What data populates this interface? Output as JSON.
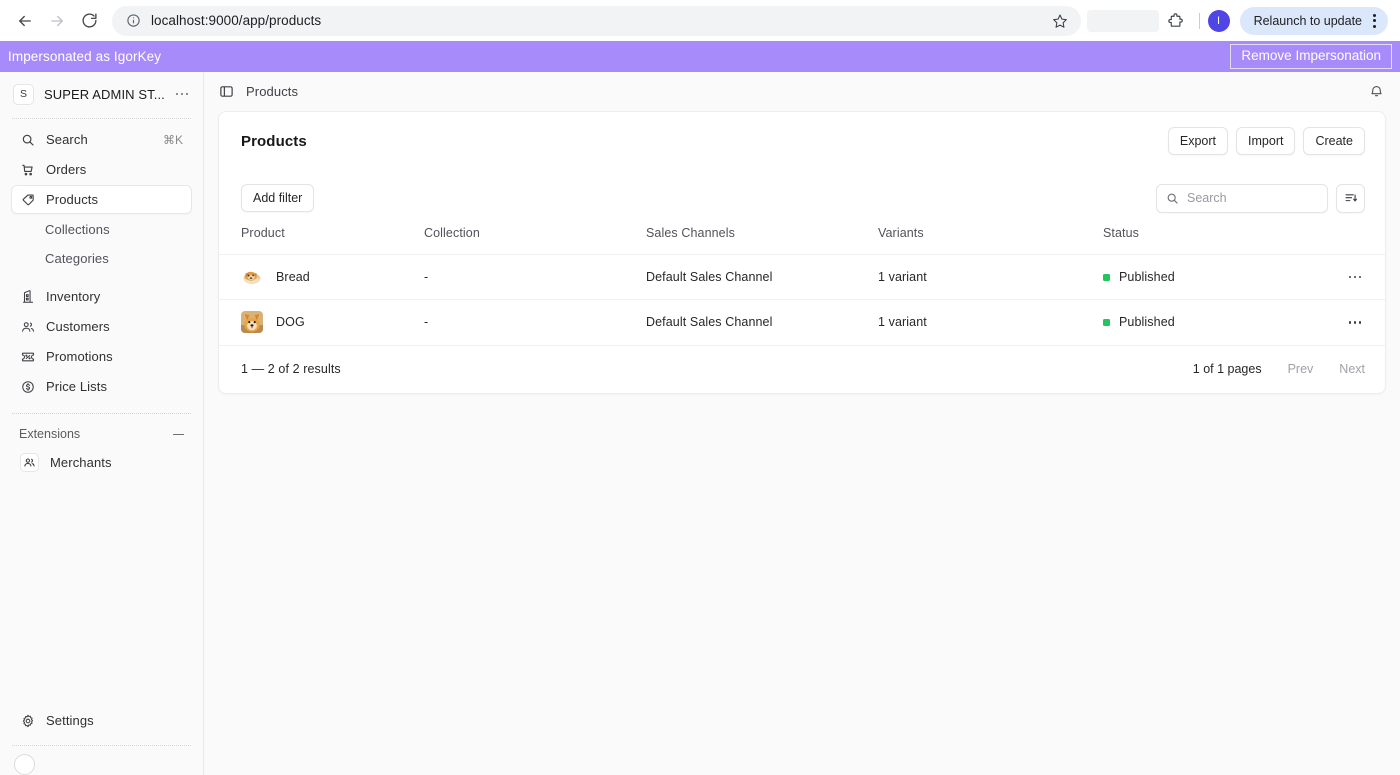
{
  "browser": {
    "back_icon": "arrow-left-icon",
    "forward_icon": "arrow-right-icon",
    "reload_icon": "reload-icon",
    "site_info_icon": "info-circle-icon",
    "url": "localhost:9000/app/products",
    "bookmark_icon": "star-icon",
    "extensions_icon": "puzzle-icon",
    "profile_initial": "I",
    "relaunch_label": "Relaunch to update",
    "kebab_icon": "three-dots-vertical-icon"
  },
  "impersonation": {
    "text": "Impersonated as IgorKey",
    "button_label": "Remove Impersonation",
    "banner_color": "#a78bfa"
  },
  "sidebar": {
    "store_initial": "S",
    "store_name": "SUPER ADMIN ST...",
    "store_menu_icon": "three-dots-icon",
    "items": [
      {
        "label": "Search",
        "icon": "search-icon",
        "shortcut": "⌘K",
        "active": false
      },
      {
        "label": "Orders",
        "icon": "cart-icon",
        "shortcut": "",
        "active": false
      },
      {
        "label": "Products",
        "icon": "tag-icon",
        "shortcut": "",
        "active": true
      }
    ],
    "sub_items": [
      {
        "label": "Collections"
      },
      {
        "label": "Categories"
      }
    ],
    "items2": [
      {
        "label": "Inventory",
        "icon": "building-icon"
      },
      {
        "label": "Customers",
        "icon": "users-icon"
      },
      {
        "label": "Promotions",
        "icon": "ticket-percent-icon"
      },
      {
        "label": "Price Lists",
        "icon": "dollar-circle-icon"
      }
    ],
    "extensions_label": "Extensions",
    "extensions_collapse_icon": "minus-icon",
    "extension_items": [
      {
        "label": "Merchants",
        "icon": "merchants-icon"
      }
    ],
    "settings": {
      "label": "Settings",
      "icon": "gear-icon"
    },
    "footer_avatar": "user-avatar"
  },
  "topbar": {
    "toggle_icon": "sidebar-toggle-icon",
    "breadcrumb": "Products",
    "bell_icon": "bell-icon"
  },
  "page": {
    "title": "Products",
    "actions": [
      {
        "label": "Export"
      },
      {
        "label": "Import"
      },
      {
        "label": "Create"
      }
    ],
    "add_filter_label": "Add filter",
    "search": {
      "placeholder": "Search",
      "value": "",
      "icon": "search-icon"
    },
    "sort_icon": "sort-descending-icon"
  },
  "table": {
    "columns": [
      "Product",
      "Collection",
      "Sales Channels",
      "Variants",
      "Status"
    ],
    "rows": [
      {
        "thumbnail": "doge-bread-thumbnail",
        "product": "Bread",
        "collection": "-",
        "sales_channels": "Default Sales Channel",
        "variants": "1 variant",
        "status": "Published",
        "status_color": "#22c55e",
        "row_menu_icon": "three-dots-icon"
      },
      {
        "thumbnail": "shiba-inu-thumbnail",
        "product": "DOG",
        "collection": "-",
        "sales_channels": "Default Sales Channel",
        "variants": "1 variant",
        "status": "Published",
        "status_color": "#22c55e",
        "row_menu_icon": "three-dots-icon"
      }
    ]
  },
  "footer": {
    "results": "1 — 2 of 2 results",
    "pages": "1 of 1 pages",
    "prev_label": "Prev",
    "next_label": "Next"
  }
}
